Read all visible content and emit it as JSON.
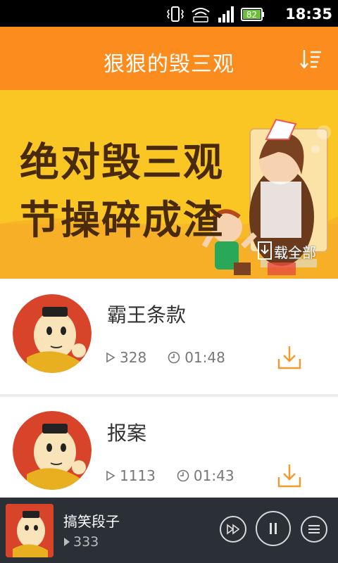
{
  "status_bar": {
    "time": "18:35",
    "battery": "82"
  },
  "header": {
    "title": "狠狠的毁三观"
  },
  "banner": {
    "line1": "绝对毁三观",
    "line2": "节操碎成渣",
    "download_all_label": "载全部"
  },
  "list": {
    "items": [
      {
        "title": "霸王条款",
        "plays": "328",
        "duration": "01:48"
      },
      {
        "title": "报案",
        "plays": "1113",
        "duration": "01:43"
      }
    ]
  },
  "player": {
    "title": "搞笑段子",
    "plays": "333"
  },
  "colors": {
    "accent": "#fb8c1d",
    "banner_bg": "#f9c623",
    "player_bg": "#2b2f36"
  }
}
